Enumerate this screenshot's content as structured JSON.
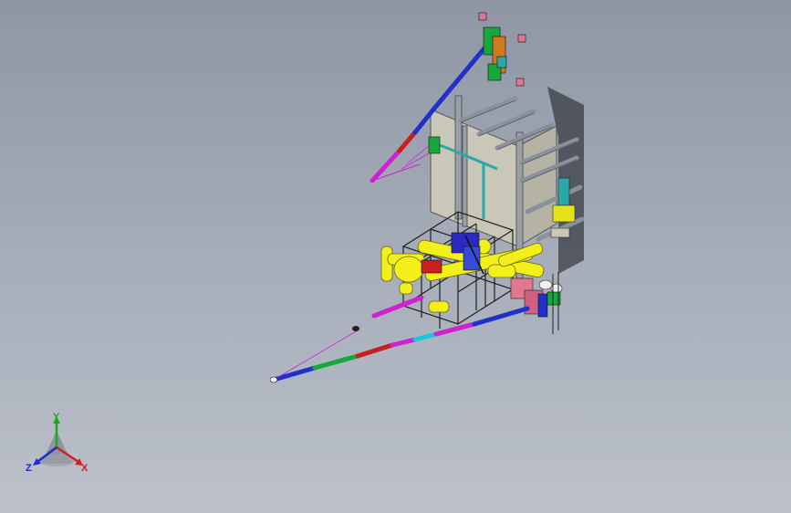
{
  "viewport": {
    "background_top": "#8e96a4",
    "background_bottom": "#bcc1ca"
  },
  "colors": {
    "frame_steel": "#9aa0a8",
    "panel": "#c9c8b8",
    "shadow": "#3a3d44",
    "pipe_yellow": "#f2ef1a",
    "cage": "#1f1f1f",
    "arm_blue": "#2030c8",
    "arm_magenta": "#d020d0",
    "arm_red": "#c81e1e",
    "arm_green": "#16a83a",
    "arm_cyan": "#18c8d8",
    "pink_part": "#e07890",
    "teal": "#2aa8a8"
  },
  "triad": {
    "x_label": "X",
    "y_label": "Y",
    "z_label": "Z",
    "x_color": "#d21e1e",
    "y_color": "#1ea81e",
    "z_color": "#1e2ad2"
  }
}
